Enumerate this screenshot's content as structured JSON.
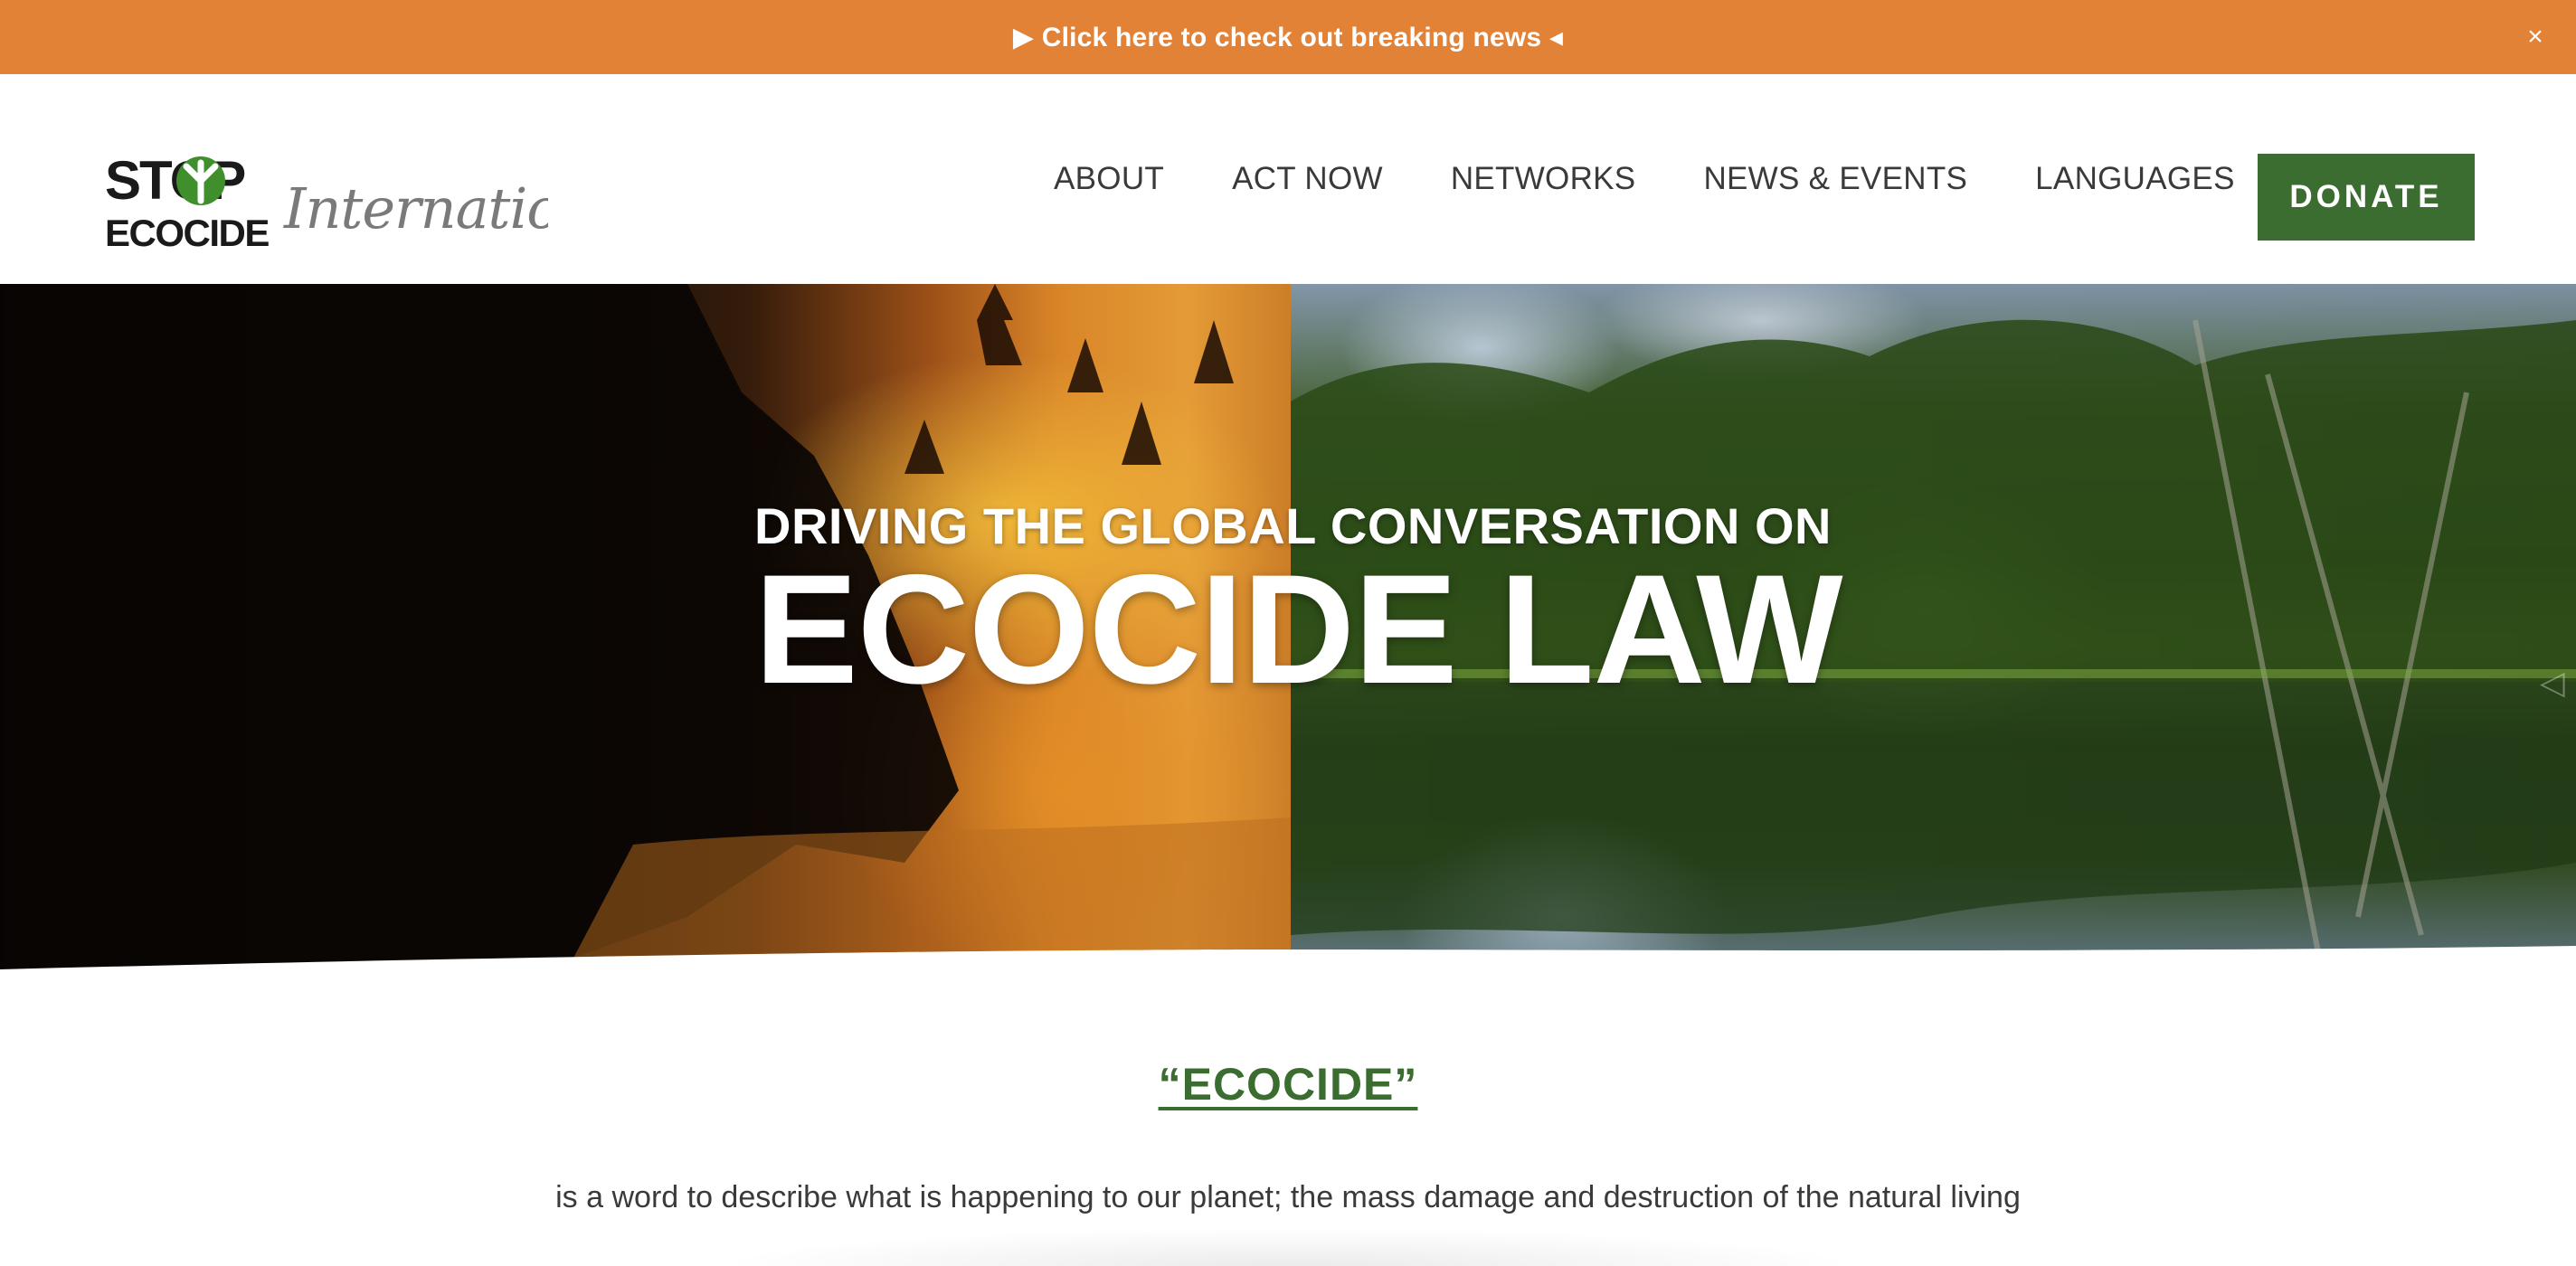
{
  "announcement": {
    "text": "▶ Click here to check out breaking news ◂",
    "close_glyph": "×",
    "background": "#e28237"
  },
  "header": {
    "logo": {
      "line1": "STOP",
      "line2": "ECOCIDE",
      "script": "International",
      "accent": "#3f8f2c"
    },
    "nav": [
      {
        "label": "ABOUT"
      },
      {
        "label": "ACT NOW"
      },
      {
        "label": "NETWORKS"
      },
      {
        "label": "NEWS & EVENTS"
      },
      {
        "label": "LANGUAGES"
      }
    ],
    "donate_label": "DONATE",
    "donate_color": "#3a6d2f"
  },
  "hero": {
    "kicker": "DRIVING THE GLOBAL CONVERSATION ON",
    "title": "ECOCIDE LAW",
    "slider_arrow_glyph": "◁"
  },
  "intro": {
    "heading": "“ECOCIDE”",
    "body": "is a word to describe what is happening to our planet; the mass damage and destruction of the natural living"
  }
}
